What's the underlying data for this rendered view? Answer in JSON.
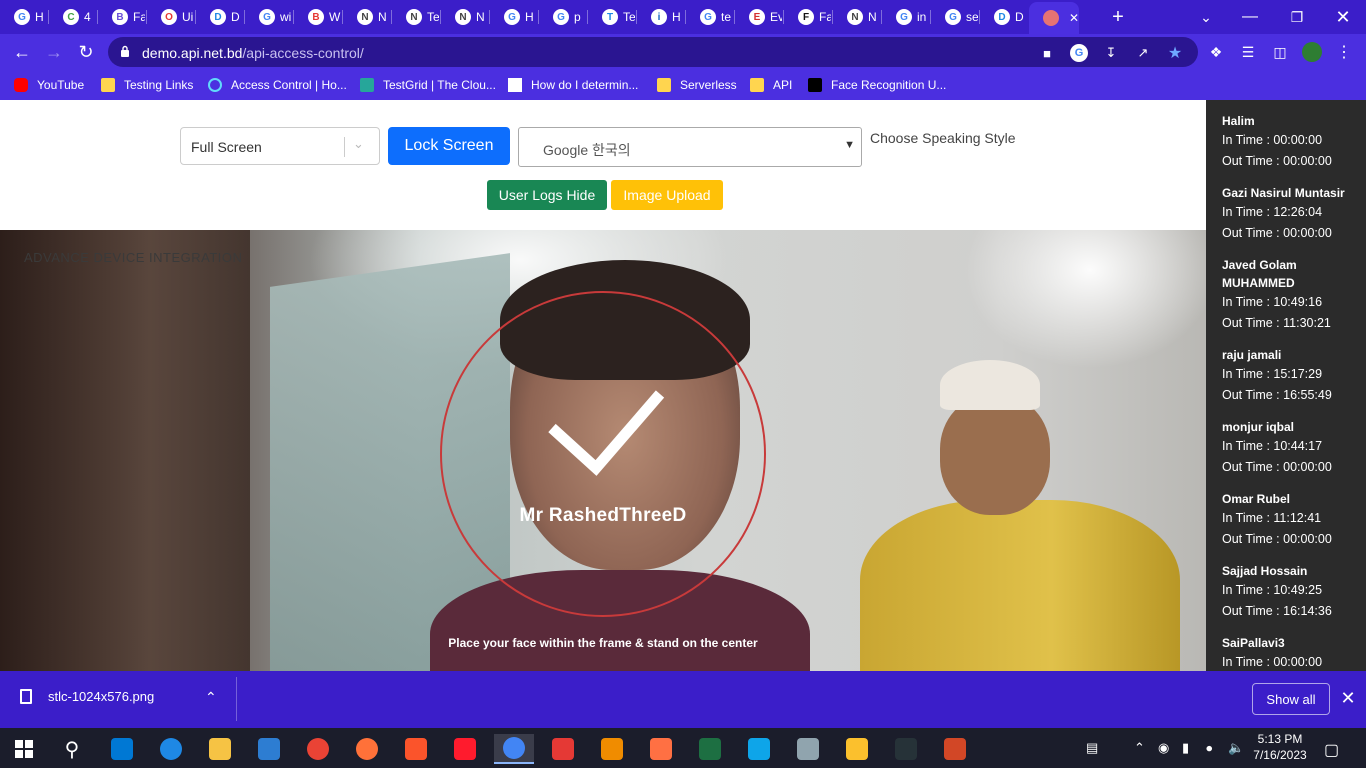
{
  "browser": {
    "tabs": [
      {
        "label": "H",
        "fav": "G",
        "color": "#4285f4"
      },
      {
        "label": "4",
        "fav": "C",
        "color": "#43a047"
      },
      {
        "label": "Fa",
        "fav": "B",
        "color": "#6a4fd9"
      },
      {
        "label": "Ui",
        "fav": "O",
        "color": "#e53935"
      },
      {
        "label": "D",
        "fav": "D",
        "color": "#1e88e5"
      },
      {
        "label": "wi",
        "fav": "G",
        "color": "#4285f4"
      },
      {
        "label": "W",
        "fav": "B",
        "color": "#e53935"
      },
      {
        "label": "N",
        "fav": "N",
        "color": "#444444"
      },
      {
        "label": "Te",
        "fav": "N",
        "color": "#444444"
      },
      {
        "label": "N",
        "fav": "N",
        "color": "#444444"
      },
      {
        "label": "H",
        "fav": "G",
        "color": "#4285f4"
      },
      {
        "label": "p",
        "fav": "G",
        "color": "#4285f4"
      },
      {
        "label": "Te",
        "fav": "T",
        "color": "#1e88e5"
      },
      {
        "label": "H",
        "fav": "i",
        "color": "#1565c0"
      },
      {
        "label": "te",
        "fav": "G",
        "color": "#4285f4"
      },
      {
        "label": "Ev",
        "fav": "E",
        "color": "#d32f2f"
      },
      {
        "label": "Fa",
        "fav": "F",
        "color": "#111111"
      },
      {
        "label": "N",
        "fav": "N",
        "color": "#444444"
      },
      {
        "label": "in",
        "fav": "G",
        "color": "#4285f4"
      },
      {
        "label": "se",
        "fav": "G",
        "color": "#4285f4"
      },
      {
        "label": "D",
        "fav": "D",
        "color": "#1e88e5"
      },
      {
        "label": "",
        "fav": "",
        "color": "#e57373"
      }
    ],
    "new_tab_label": "+",
    "url_host": "demo.api.net.bd",
    "url_path": "/api-access-control/",
    "bookmarks": [
      {
        "label": "YouTube",
        "icon": "youtube-icon"
      },
      {
        "label": "Testing Links",
        "icon": "folder-icon"
      },
      {
        "label": "Access Control | Ho...",
        "icon": "react-icon"
      },
      {
        "label": "TestGrid | The Clou...",
        "icon": "testgrid-icon"
      },
      {
        "label": "How do I determin...",
        "icon": "r-icon"
      },
      {
        "label": "Serverless",
        "icon": "folder-icon"
      },
      {
        "label": "API",
        "icon": "folder-icon"
      },
      {
        "label": "Face Recognition U...",
        "icon": "medium-icon"
      }
    ]
  },
  "controls": {
    "screen_mode": "Full Screen",
    "lock_button": "Lock Screen",
    "voice": "Google 한국의",
    "speaking_style_label": "Choose Speaking Style",
    "logs_button": "User Logs Hide",
    "upload_button": "Image Upload"
  },
  "camera": {
    "overlay_title": "ADVANCE DEVICE INTEGRATION",
    "detected_name": "Mr RashedThreeD",
    "instruction": "Place your face within the frame & stand on the center",
    "status": "check-icon"
  },
  "logs": [
    {
      "name": "Halim",
      "in": "In Time : 00:00:00",
      "out": "Out Time : 00:00:00"
    },
    {
      "name": "Gazi Nasirul Muntasir",
      "in": "In Time : 12:26:04",
      "out": "Out Time : 00:00:00"
    },
    {
      "name": "Javed Golam MUHAMMED",
      "in": "In Time : 10:49:16",
      "out": "Out Time : 11:30:21"
    },
    {
      "name": "raju jamali",
      "in": "In Time : 15:17:29",
      "out": "Out Time : 16:55:49"
    },
    {
      "name": "monjur iqbal",
      "in": "In Time : 10:44:17",
      "out": "Out Time : 00:00:00"
    },
    {
      "name": "Omar Rubel",
      "in": "In Time : 11:12:41",
      "out": "Out Time : 00:00:00"
    },
    {
      "name": "Sajjad Hossain",
      "in": "In Time : 10:49:25",
      "out": "Out Time : 16:14:36"
    },
    {
      "name": "SaiPallavi3",
      "in": "In Time : 00:00:00",
      "out": ""
    }
  ],
  "download": {
    "filename": "stlc-1024x576.png",
    "show_all": "Show all"
  },
  "taskbar": {
    "time": "5:13 PM",
    "date": "7/16/2023",
    "apps": [
      "#0078d4",
      "#1e88e5",
      "#f6c344",
      "#2d7dd2",
      "#ea4335",
      "#ff7139",
      "#fb542b",
      "#ff1b2d",
      "#4285f4",
      "#e53935",
      "#f08c00",
      "#ff7043",
      "#1d6f42",
      "#0ea5e9",
      "#90a4ae",
      "#fbc02d",
      "#263238",
      "#d24726"
    ]
  }
}
